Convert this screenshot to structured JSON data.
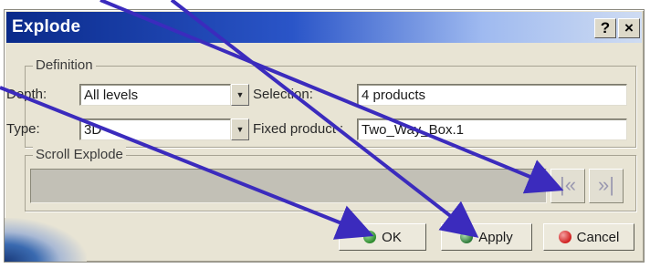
{
  "dialog": {
    "title": "Explode",
    "help_label": "?",
    "close_label": "×"
  },
  "definition": {
    "group_label": "Definition",
    "depth_label": "Depth:",
    "depth_value": "All levels",
    "type_label": "Type:",
    "type_value": "3D",
    "selection_label": "Selection:",
    "selection_value": "4 products",
    "fixed_product_label": "Fixed product :",
    "fixed_product_value": "Two_Way_Box.1"
  },
  "scroll_explode": {
    "group_label": "Scroll Explode",
    "first_button": "|«",
    "last_button": "»|"
  },
  "buttons": {
    "ok": "OK",
    "apply": "Apply",
    "cancel": "Cancel"
  },
  "colors": {
    "arrow": "#3b2bbd",
    "ok_icon": "#2e8b2e",
    "apply_icon": "#2e7a3a",
    "cancel_icon": "#d02020"
  }
}
